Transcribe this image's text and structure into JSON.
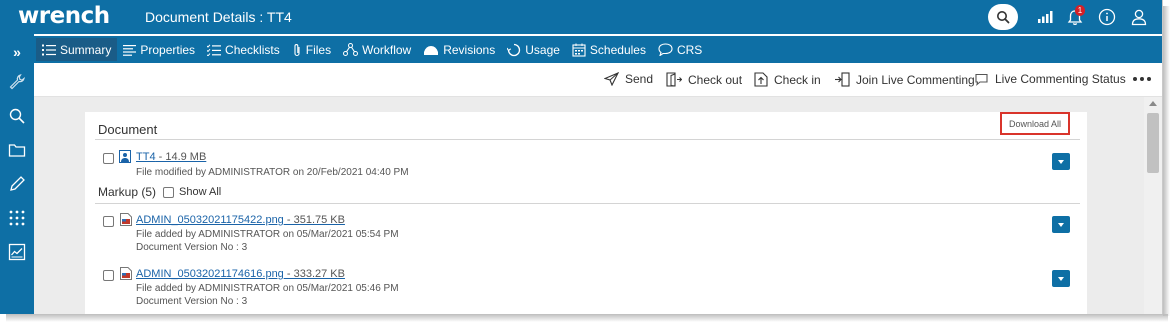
{
  "app": {
    "logo": "wrench",
    "title": "Document Details : TT4"
  },
  "header_icons": [
    "search-icon",
    "signal-icon",
    "bell-icon",
    "info-icon",
    "user-icon"
  ],
  "notifications": {
    "count": "1"
  },
  "sidebar": {
    "expand_label": "»",
    "items": [
      "wrench-icon",
      "search-icon",
      "folder-icon",
      "pencil-icon",
      "apps-grid-icon",
      "dashboard-icon"
    ]
  },
  "tabs": [
    {
      "label": "Summary",
      "icon": "list-icon",
      "active": true
    },
    {
      "label": "Properties",
      "icon": "lines-icon"
    },
    {
      "label": "Checklists",
      "icon": "checklist-icon"
    },
    {
      "label": "Files",
      "icon": "paperclip-icon"
    },
    {
      "label": "Workflow",
      "icon": "workflow-icon"
    },
    {
      "label": "Revisions",
      "icon": "revisions-icon"
    },
    {
      "label": "Usage",
      "icon": "usage-icon"
    },
    {
      "label": "Schedules",
      "icon": "calendar-icon"
    },
    {
      "label": "CRS",
      "icon": "chat-icon"
    }
  ],
  "actions": [
    {
      "label": "Send",
      "icon": "send-icon"
    },
    {
      "label": "Check out",
      "icon": "check-out-icon"
    },
    {
      "label": "Check in",
      "icon": "check-in-icon"
    },
    {
      "label": "Join Live Commenting",
      "icon": "join-commenting-icon"
    },
    {
      "label": "Live Commenting Status",
      "icon": "comment-status-icon"
    }
  ],
  "document": {
    "section_title": "Document",
    "download_all": "Download All",
    "file": {
      "name": "TT4",
      "size": " - 14.9 MB",
      "meta": "File modified by ADMINISTRATOR on 20/Feb/2021 04:40 PM"
    }
  },
  "markup": {
    "title": "Markup (5)",
    "show_all": "Show All",
    "files": [
      {
        "name": "ADMIN_05032021175422.png",
        "size": " - 351.75 KB",
        "meta": "File added by ADMINISTRATOR on 05/Mar/2021 05:54 PM",
        "version": "Document Version No : 3"
      },
      {
        "name": "ADMIN_05032021174616.png",
        "size": " - 333.27 KB",
        "meta": "File added by ADMINISTRATOR on 05/Mar/2021 05:46 PM",
        "version": "Document Version No : 3"
      }
    ]
  },
  "colors": {
    "primary": "#0e6fa5",
    "active_tab": "#1a5c87",
    "link": "#1a63a8",
    "highlight": "#d9342b"
  }
}
